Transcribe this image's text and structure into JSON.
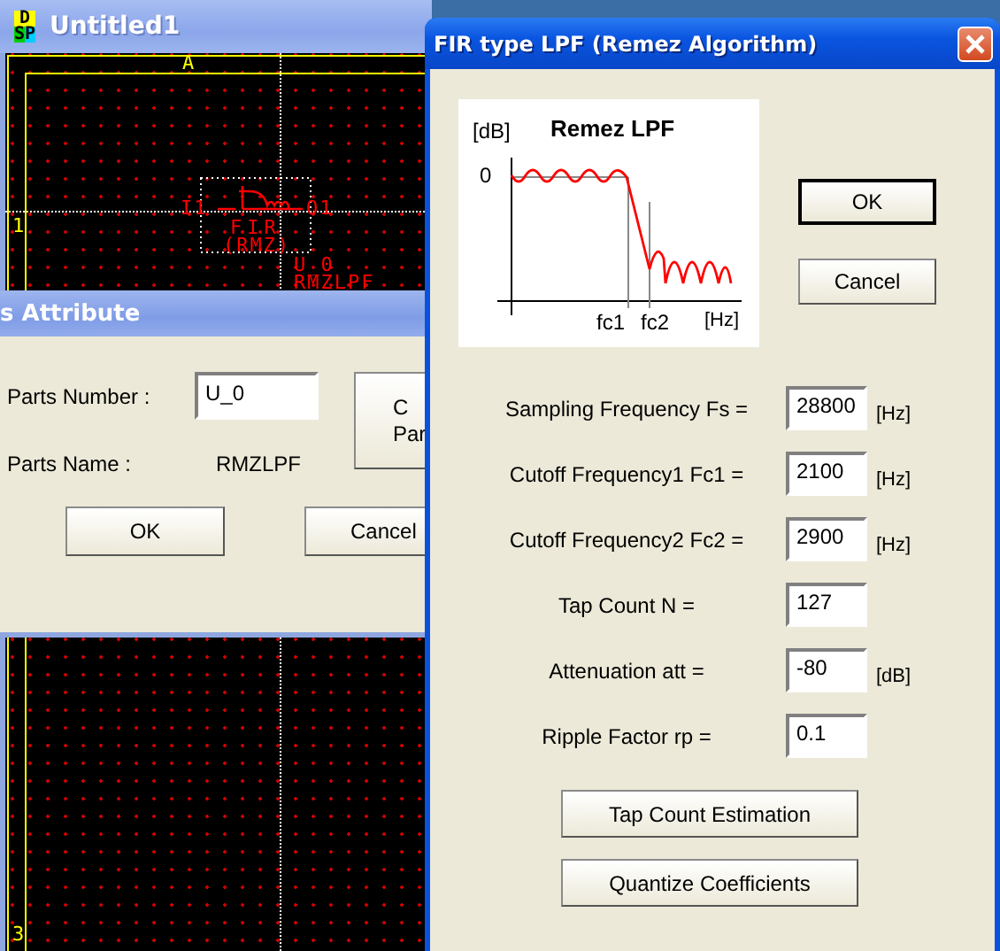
{
  "editor_window": {
    "title": "Untitled1",
    "app_icon": [
      "D",
      "S",
      "P"
    ],
    "canvas": {
      "column_label": "A",
      "row_labels": [
        "1",
        "3"
      ],
      "part": {
        "pin_in": "I1",
        "pin_out": "O1",
        "line_1": "FIR",
        "line_2": "(RMZ)",
        "reference": "U_0",
        "name": "RMZLPF"
      }
    }
  },
  "attribute_dialog": {
    "title": "s Attribute",
    "fields": [
      {
        "kind": "input",
        "label": "Parts Number :",
        "value": "U_0"
      },
      {
        "kind": "text",
        "label": "Parts Name :",
        "value": "RMZLPF"
      }
    ],
    "side_button": [
      "C",
      "Par"
    ],
    "buttons": [
      "OK",
      "Cancel"
    ]
  },
  "fir_dialog": {
    "title": "FIR type LPF (Remez Algorithm)",
    "graph": {
      "title": "Remez LPF",
      "y_unit": "[dB]",
      "y_zero": "0",
      "x_labels": [
        "fc1",
        "fc2"
      ],
      "x_unit": "[Hz]"
    },
    "buttons": [
      {
        "label": "OK",
        "default": true
      },
      {
        "label": "Cancel",
        "default": false
      }
    ],
    "params": [
      {
        "label": "Sampling Frequency Fs =",
        "value": "28800",
        "unit": "[Hz]"
      },
      {
        "label": "Cutoff Frequency1 Fc1 =",
        "value": "2100",
        "unit": "[Hz]"
      },
      {
        "label": "Cutoff Frequency2 Fc2 =",
        "value": "2900",
        "unit": "[Hz]"
      },
      {
        "label": "Tap Count N =",
        "value": "127"
      },
      {
        "label": "Attenuation att =",
        "value": "-80",
        "unit": "[dB]"
      },
      {
        "label": "Ripple Factor rp =",
        "value": "0.1"
      }
    ],
    "actions": [
      "Tap Count Estimation",
      "Quantize Coefficients"
    ]
  }
}
